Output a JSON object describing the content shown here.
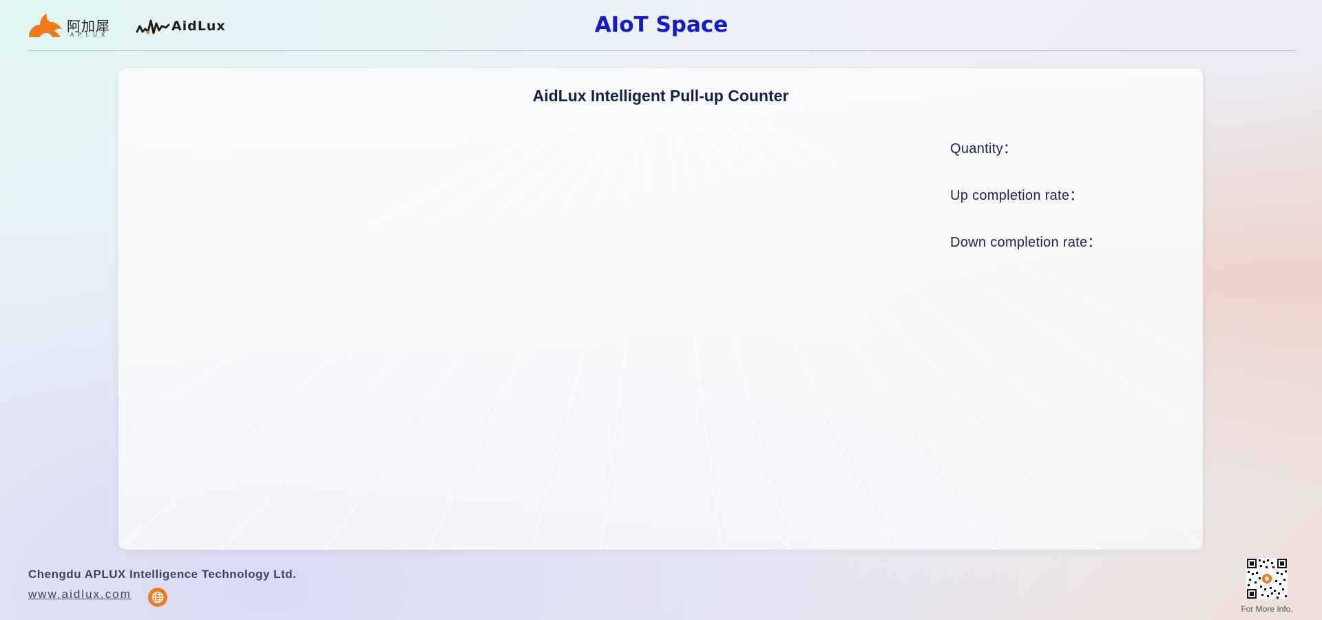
{
  "header": {
    "aplux_logo_cn": "阿加犀",
    "aplux_logo_en": "APLUX",
    "aidlux_logo": "AidLux",
    "title": "AIoT Space",
    "title_color": "#1219d4"
  },
  "main": {
    "title": "AidLux  Intelligent Pull-up Counter",
    "stats": [
      {
        "label": "Quantity：",
        "value": ""
      },
      {
        "label": "Up completion rate：",
        "value": ""
      },
      {
        "label": "Down completion rate：",
        "value": ""
      }
    ]
  },
  "footer": {
    "company": "Chengdu APLUX Intelligence Technology Ltd.",
    "website": "www.aidlux.com",
    "qr_caption": "For More Info.",
    "globe_icon": "globe-icon",
    "accent_color": "#f07a1a"
  }
}
